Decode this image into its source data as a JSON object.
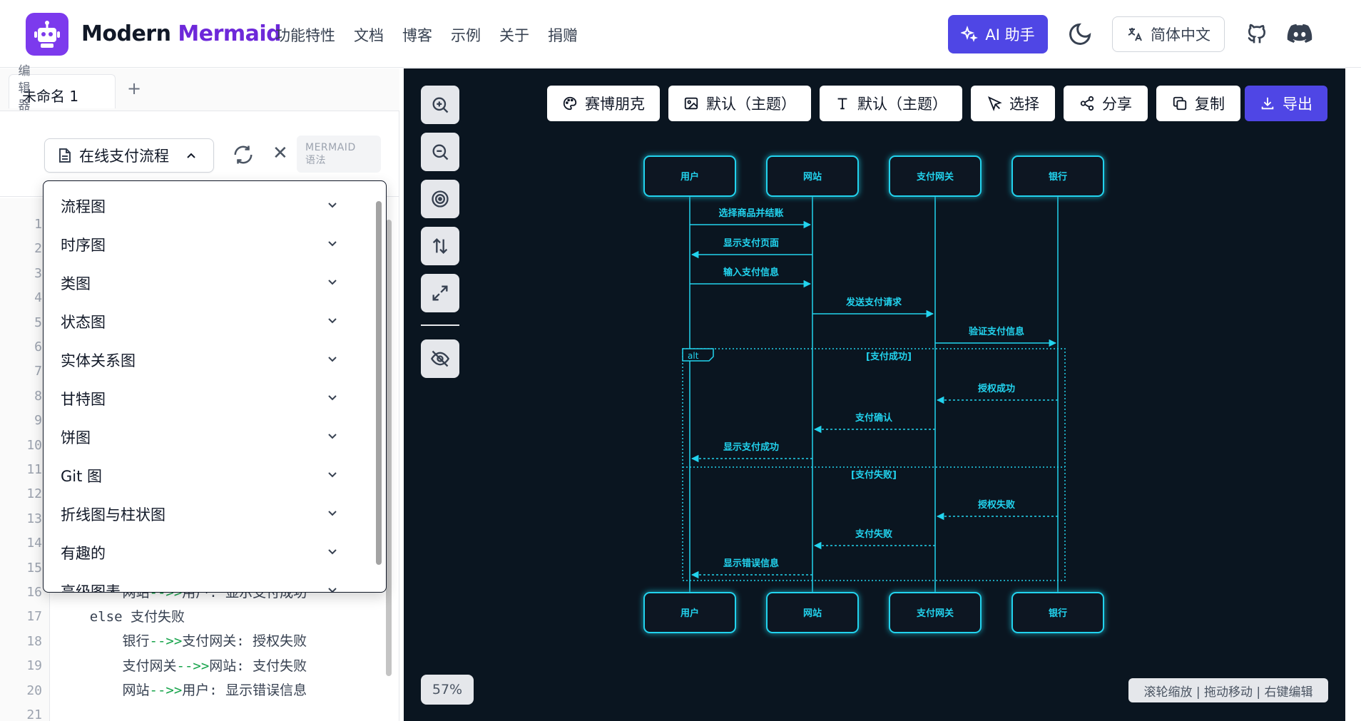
{
  "header": {
    "brand_main": "Modern",
    "brand_accent": "Mermaid",
    "nav": [
      "功能特性",
      "文档",
      "博客",
      "示例",
      "关于",
      "捐赠"
    ],
    "ai_button": "AI 助手",
    "language": "简体中文"
  },
  "editor": {
    "tab_label": "未命名 1",
    "add_tab": "+",
    "vertical_label": "编辑器",
    "template_select": "在线支付流程",
    "syntax_badge_line1": "MERMAID",
    "syntax_badge_line2": "语法",
    "line_numbers": [
      "1",
      "2",
      "3",
      "4",
      "5",
      "6",
      "7",
      "8",
      "9",
      "10",
      "11",
      "12",
      "13",
      "14",
      "15",
      "16",
      "17",
      "18",
      "19",
      "20",
      "21"
    ],
    "visible_code": [
      {
        "indent": "        ",
        "from": "网站",
        "arrow": "-->>",
        "rest": "用户: 显示支付成功"
      },
      {
        "indent": "    ",
        "from": "else 支付失败",
        "arrow": "",
        "rest": ""
      },
      {
        "indent": "        ",
        "from": "银行",
        "arrow": "-->>",
        "rest": "支付网关: 授权失败"
      },
      {
        "indent": "        ",
        "from": "支付网关",
        "arrow": "-->>",
        "rest": "网站: 支付失败"
      },
      {
        "indent": "        ",
        "from": "网站",
        "arrow": "-->>",
        "rest": "用户: 显示错误信息"
      }
    ]
  },
  "dropdown": {
    "items": [
      "流程图",
      "时序图",
      "类图",
      "状态图",
      "实体关系图",
      "甘特图",
      "饼图",
      "Git 图",
      "折线图与柱状图",
      "有趣的",
      "高级图表"
    ]
  },
  "canvas_toolbar": {
    "theme": "赛博朋克",
    "background": "默认（主题）",
    "font": "默认（主题）",
    "select": "选择",
    "share": "分享",
    "copy": "复制",
    "export": "导出"
  },
  "canvas_status": {
    "zoom": "57%",
    "hint": "滚轮缩放 | 拖动移动 | 右键编辑"
  },
  "diagram": {
    "participants": [
      "用户",
      "网站",
      "支付网关",
      "银行"
    ],
    "messages": [
      {
        "from": 0,
        "to": 1,
        "text": "选择商品并结账",
        "dashed": false
      },
      {
        "from": 1,
        "to": 0,
        "text": "显示支付页面",
        "dashed": false
      },
      {
        "from": 0,
        "to": 1,
        "text": "输入支付信息",
        "dashed": false
      },
      {
        "from": 1,
        "to": 2,
        "text": "发送支付请求",
        "dashed": false
      },
      {
        "from": 2,
        "to": 3,
        "text": "验证支付信息",
        "dashed": false
      },
      {
        "from": 3,
        "to": 2,
        "text": "授权成功",
        "dashed": true
      },
      {
        "from": 2,
        "to": 1,
        "text": "支付确认",
        "dashed": true
      },
      {
        "from": 1,
        "to": 0,
        "text": "显示支付成功",
        "dashed": true
      },
      {
        "from": 3,
        "to": 2,
        "text": "授权失败",
        "dashed": true
      },
      {
        "from": 2,
        "to": 1,
        "text": "支付失败",
        "dashed": true
      },
      {
        "from": 1,
        "to": 0,
        "text": "显示错误信息",
        "dashed": true
      }
    ],
    "alt_label": "alt",
    "alt_condition_1": "[支付成功]",
    "alt_condition_2": "[支付失败]",
    "color": "#22d3ee"
  }
}
